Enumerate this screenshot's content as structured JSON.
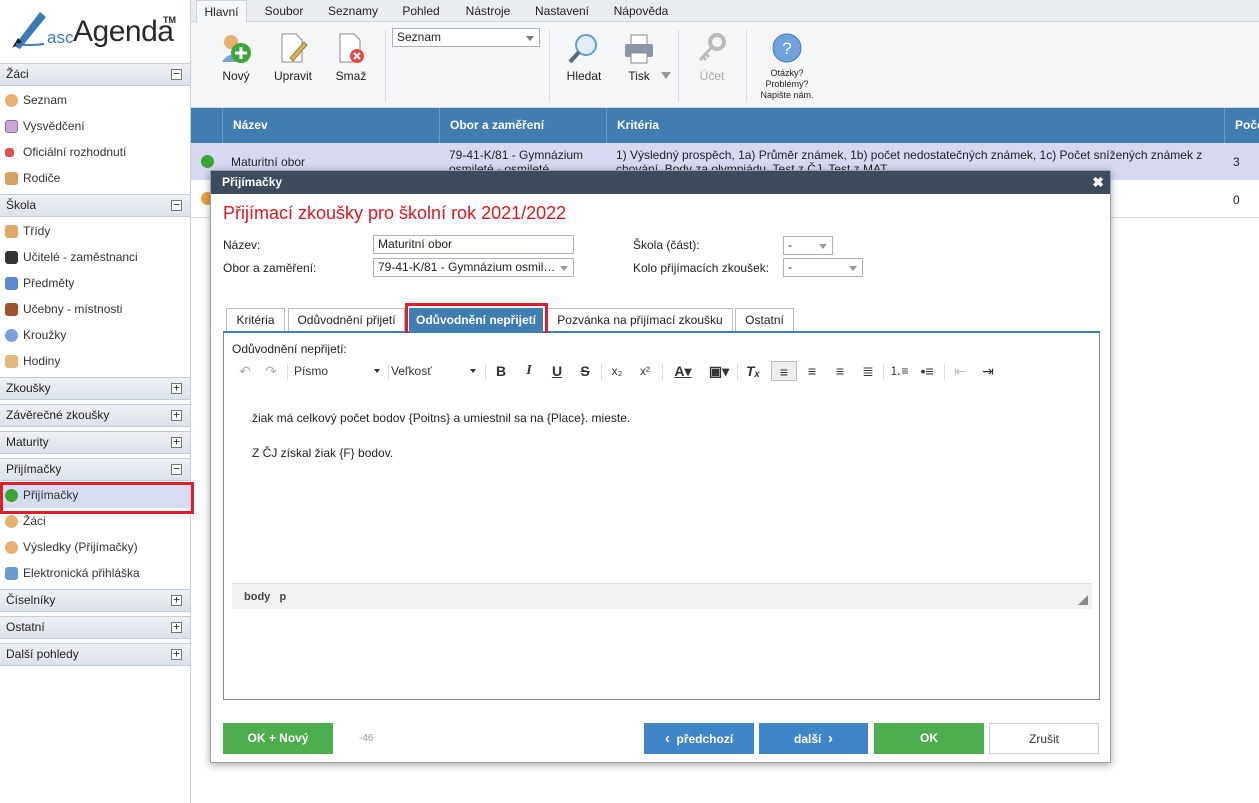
{
  "app": {
    "logo_small": "asc",
    "logo_big": "Agenda",
    "logo_tm": "TM"
  },
  "sidebar": {
    "sections": [
      {
        "label": "Žáci",
        "toggle": "−"
      },
      {
        "label": "Škola",
        "toggle": "−"
      },
      {
        "label": "Zkoušky",
        "toggle": "+"
      },
      {
        "label": "Závěrečné zkoušky",
        "toggle": "+"
      },
      {
        "label": "Maturity",
        "toggle": "+"
      },
      {
        "label": "Přijímačky",
        "toggle": "−"
      },
      {
        "label": "Číselníky",
        "toggle": "+"
      },
      {
        "label": "Ostatní",
        "toggle": "+"
      },
      {
        "label": "Další pohledy",
        "toggle": "+"
      }
    ],
    "items": [
      {
        "label": "Seznam",
        "icon": "user-icon"
      },
      {
        "label": "Vysvědčení",
        "icon": "certificate-icon"
      },
      {
        "label": "Oficiální rozhodnutí",
        "icon": "pin-icon"
      },
      {
        "label": "Rodiče",
        "icon": "parents-icon"
      },
      {
        "label": "Třídy",
        "icon": "class-icon"
      },
      {
        "label": "Učitelé - zaměstnanci",
        "icon": "graduation-cap-icon"
      },
      {
        "label": "Předměty",
        "icon": "book-icon"
      },
      {
        "label": "Učebny - místnosti",
        "icon": "door-icon"
      },
      {
        "label": "Kroužky",
        "icon": "ring-icon"
      },
      {
        "label": "Hodiny",
        "icon": "clock-icon"
      },
      {
        "label": "Přijímačky",
        "icon": "add-green-icon"
      },
      {
        "label": "Žáci",
        "icon": "user-icon"
      },
      {
        "label": "Výsledky (Přijímačky)",
        "icon": "results-icon"
      },
      {
        "label": "Elektronická přihláška",
        "icon": "id-card-icon"
      }
    ]
  },
  "menubar": [
    "Hlavní",
    "Soubor",
    "Seznamy",
    "Pohled",
    "Nástroje",
    "Nastavení",
    "Nápověda"
  ],
  "toolbar": {
    "new_label": "Nový",
    "edit_label": "Upravit",
    "delete_label": "Smaž",
    "view_select": "Seznam",
    "search_label": "Hledat",
    "print_label": "Tisk",
    "account_label": "Účet",
    "help_line1": "Otázky?",
    "help_line2": "Problémy?",
    "help_line3": "Napište nám."
  },
  "grid": {
    "columns": [
      "Název",
      "Obor a zaměření",
      "Kritéria",
      "Poče"
    ],
    "rows": [
      {
        "name": "Maturitní obor",
        "obor1": "79-41-K/81 - Gymnázium",
        "obor2": "osmileté - osmileté",
        "krit1": "1) Výsledný prospěch, 1a) Průměr známek, 1b) počet nedostatečných známek, 1c) Počet snížených známek z",
        "krit2": "chování, Body za olympiádu, Test z ČJ, Test z MAT",
        "count": "3"
      },
      {
        "name": "",
        "obor1": "",
        "obor2": "",
        "krit1": "",
        "krit2": "",
        "count": "0"
      }
    ]
  },
  "dialog": {
    "header": "Přijímačky",
    "close": "✖",
    "title": "Přijímací zkoušky pro školní rok 2021/2022",
    "fields": {
      "nazev_label": "Název:",
      "nazev_value": "Maturitní obor",
      "obor_label": "Obor a zaměření:",
      "obor_value": "79-41-K/81 - Gymnázium osmil…",
      "skola_label": "Škola (část):",
      "skola_value": "-",
      "kolo_label": "Kolo přijímacích zkoušek:",
      "kolo_value": "-"
    },
    "tabs": [
      "Kritéria",
      "Odůvodnění přijetí",
      "Odůvodnění nepřijetí",
      "Pozvánka na přijímací zkoušku",
      "Ostatní"
    ],
    "editor": {
      "label": "Odůvodnění nepřijetí:",
      "font_select": "Písmo",
      "size_select": "Veľkosť",
      "paragraph1": "žiak má celkový počet bodov {Poitns} a umiestnil sa na {Place}. mieste.",
      "paragraph2": "Z ČJ získal žiak {F} bodov.",
      "status_body": "body",
      "status_p": "p"
    },
    "footer": {
      "ok_new": "OK + Nový",
      "counter": "-46",
      "prev": "předchozí",
      "next": "další",
      "ok": "OK",
      "cancel": "Zrušit"
    }
  },
  "colors": {
    "header_blue": "#3f7db2",
    "highlight_red": "#e01e2b",
    "ok_green": "#4cae4c",
    "title_red": "#e0161e"
  }
}
